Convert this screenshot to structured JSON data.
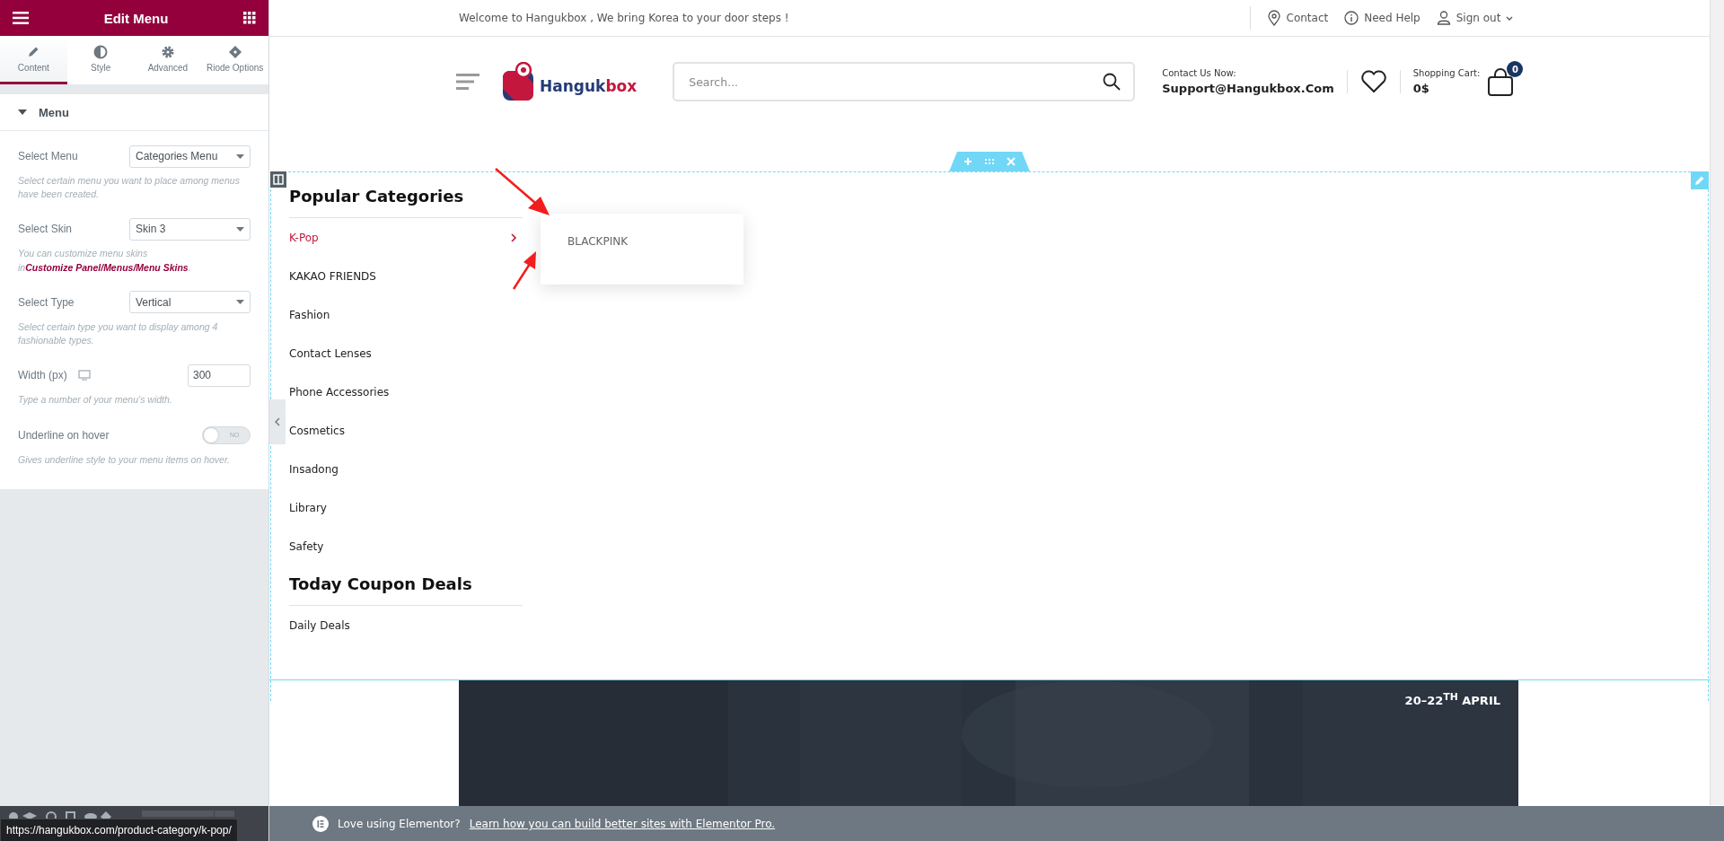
{
  "panel": {
    "title": "Edit Menu",
    "tabs": [
      {
        "label": "Content",
        "kind": "pencil",
        "selected": true
      },
      {
        "label": "Style",
        "kind": "contrast",
        "selected": false
      },
      {
        "label": "Advanced",
        "kind": "gear",
        "selected": false
      },
      {
        "label": "Riode Options",
        "kind": "diamond",
        "selected": false
      }
    ],
    "section": {
      "title": "Menu",
      "expanded": true
    },
    "controls": [
      {
        "kind": "select",
        "label": "Select Menu",
        "value": "Categories Menu",
        "help": "Select certain menu you want to place among menus have been created."
      },
      {
        "kind": "select",
        "label": "Select Skin",
        "value": "Skin 3",
        "help": "You can customize menu skins in",
        "help_link": "Customize Panel/Menus/Menu Skins",
        "help_end": "."
      },
      {
        "kind": "select",
        "label": "Select Type",
        "value": "Vertical",
        "help": "Select certain type you want to display among 4 fashionable types."
      },
      {
        "kind": "number",
        "label": "Width (px)",
        "value": "300",
        "help": "Type a number of your menu’s width."
      },
      {
        "kind": "toggle",
        "label": "Underline on hover",
        "on": false,
        "state_label": "NO",
        "help": "Gives underline style to your menu items on hover."
      }
    ]
  },
  "status_url": "https://hangukbox.com/product-category/k-pop/",
  "site": {
    "topbar": {
      "welcome": "Welcome to Hangukbox , We bring Korea to your door steps !",
      "links": [
        {
          "kind": "pin",
          "label": "Contact",
          "dropdown": false
        },
        {
          "kind": "info",
          "label": "Need Help",
          "dropdown": false
        },
        {
          "kind": "user",
          "label": "Sign out",
          "dropdown": true
        }
      ]
    },
    "header": {
      "logo": {
        "part1": "Hanguk",
        "part2": "box"
      },
      "search": {
        "placeholder": "Search..."
      },
      "contact": {
        "label": "Contact Us Now:",
        "email": "Support@Hangukbox.Com"
      },
      "cart": {
        "label": "Shopping Cart:",
        "total": "0$",
        "count": "0"
      }
    },
    "menu": [
      {
        "title": "Popular Categories",
        "items": [
          {
            "label": "K-Pop",
            "selected": true,
            "expanded": true,
            "children": [
              {
                "label": "BLACKPINK"
              }
            ]
          },
          {
            "label": "KAKAO FRIENDS",
            "selected": false
          },
          {
            "label": "Fashion",
            "selected": false
          },
          {
            "label": "Contact Lenses",
            "selected": false
          },
          {
            "label": "Phone Accessories",
            "selected": false
          },
          {
            "label": "Cosmetics",
            "selected": false
          },
          {
            "label": "Insadong",
            "selected": false
          },
          {
            "label": "Library",
            "selected": false
          },
          {
            "label": "Safety",
            "selected": false
          }
        ]
      },
      {
        "title": "Today Coupon Deals",
        "items": [
          {
            "label": "Daily Deals",
            "selected": false
          }
        ]
      }
    ],
    "banner": {
      "date": "20–22$^{TH}$ APRIL"
    },
    "notice": {
      "text": "Love using Elementor?",
      "link": "Learn how you can build better sites with Elementor Pro."
    }
  }
}
